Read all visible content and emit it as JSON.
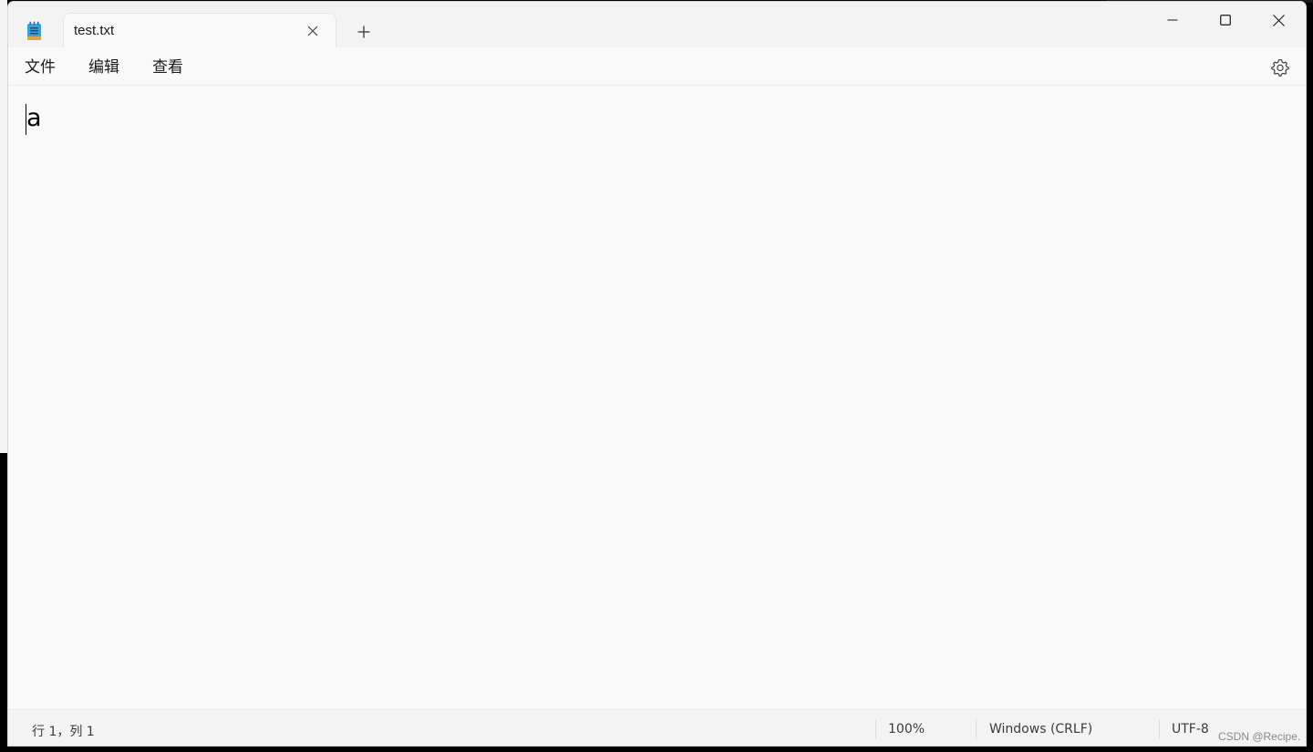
{
  "tab": {
    "title": "test.txt",
    "close_icon": "close-icon",
    "new_tab_icon": "plus-icon"
  },
  "window_controls": {
    "minimize_icon": "minimize-icon",
    "maximize_icon": "maximize-icon",
    "close_icon": "close-icon"
  },
  "menu": {
    "file": "文件",
    "edit": "编辑",
    "view": "查看",
    "settings_icon": "gear-icon"
  },
  "editor": {
    "content": "a"
  },
  "status": {
    "position": "行 1，列 1",
    "zoom": "100%",
    "line_ending": "Windows (CRLF)",
    "encoding": "UTF-8"
  },
  "watermark": "CSDN @Recipe.",
  "colors": {
    "window_bg": "#f9f9f9",
    "titlebar_bg": "#f3f3f3",
    "app_icon_accent": "#3aa0d8"
  }
}
